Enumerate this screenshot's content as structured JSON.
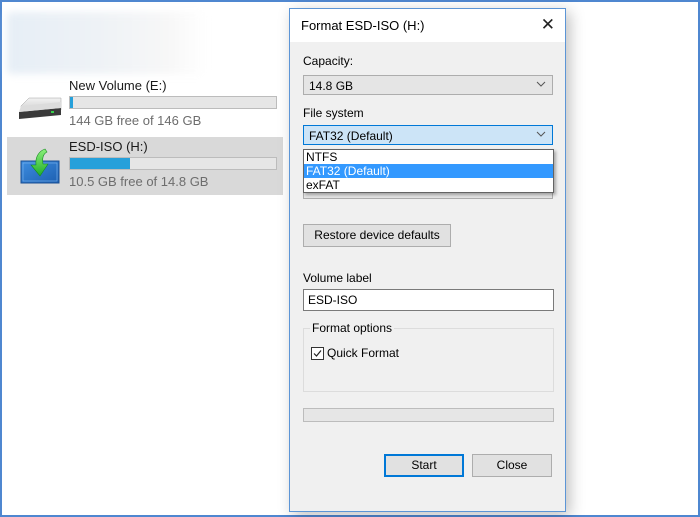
{
  "explorer": {
    "drives": [
      {
        "name": "New Volume (E:)",
        "free_text": "144 GB free of 146 GB",
        "used_fraction": 0.014,
        "icon": "hard-drive-icon",
        "selected": false
      },
      {
        "name": "ESD-ISO (H:)",
        "free_text": "10.5 GB free of 14.8 GB",
        "used_fraction": 0.29,
        "icon": "usb-drive-download-icon",
        "selected": true
      }
    ]
  },
  "dialog": {
    "title": "Format ESD-ISO (H:)",
    "close_icon": "close-icon",
    "capacity_label": "Capacity:",
    "capacity_value": "14.8 GB",
    "file_system_label": "File system",
    "file_system_value": "FAT32 (Default)",
    "file_system_options": [
      {
        "label": "NTFS",
        "selected": false
      },
      {
        "label": "FAT32 (Default)",
        "selected": true
      },
      {
        "label": "exFAT",
        "selected": false
      }
    ],
    "restore_defaults_label": "Restore device defaults",
    "volume_label_label": "Volume label",
    "volume_label_value": "ESD-ISO",
    "format_options_label": "Format options",
    "quick_format_label": "Quick Format",
    "quick_format_checked": true,
    "progress": 0,
    "start_label": "Start",
    "close_label": "Close"
  },
  "colors": {
    "accent": "#0078d7",
    "selection": "#3399ff",
    "drive_bar": "#26a0da",
    "frame_border": "#4f87d0"
  }
}
